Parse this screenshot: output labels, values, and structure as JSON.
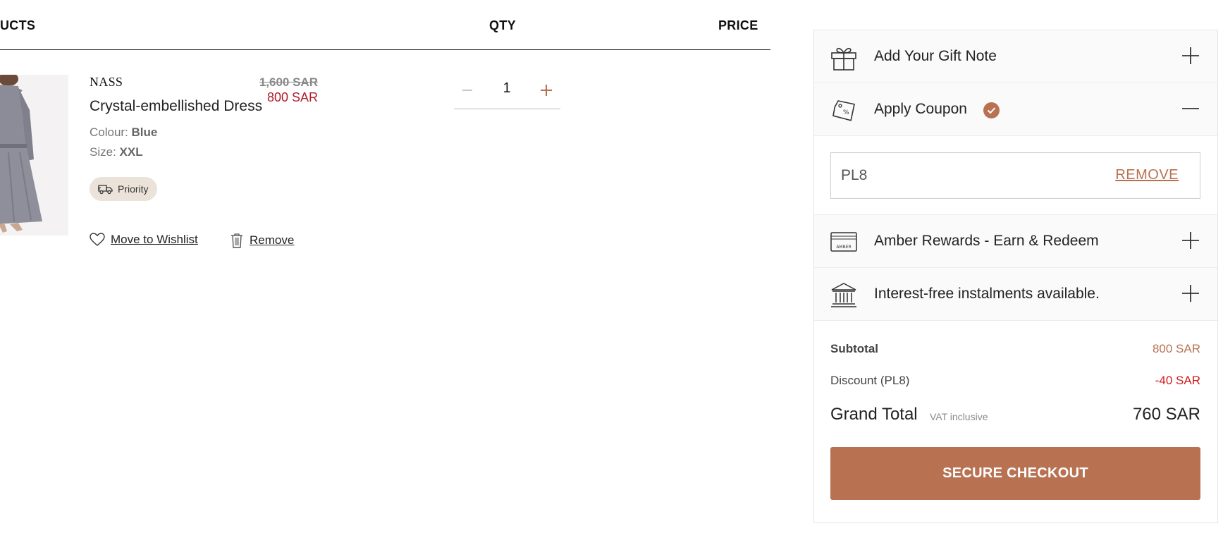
{
  "table": {
    "col_products": "UCTS",
    "col_qty": "QTY",
    "col_price": "PRICE"
  },
  "item": {
    "brand": "NASS",
    "name": "Crystal-embellished Dress",
    "colour_label": "Colour: ",
    "colour_value": "Blue",
    "size_label": "Size: ",
    "size_value": "XXL",
    "badge": "Priority",
    "wishlist_label": "Move to Wishlist",
    "remove_label": "Remove",
    "quantity": "1",
    "price_old": "1,600 SAR",
    "price_new": "800 SAR"
  },
  "summary": {
    "gift_note": "Add Your Gift Note",
    "apply_coupon": "Apply Coupon",
    "coupon_code": "PL8",
    "coupon_remove": "REMOVE",
    "rewards": "Amber Rewards - Earn & Redeem",
    "rewards_card_text": "AMBER",
    "instalments": "Interest-free instalments available.",
    "subtotal_label": "Subtotal",
    "subtotal_value": "800 SAR",
    "discount_label": "Discount (PL8)",
    "discount_value": "-40 SAR",
    "grand_total_label": "Grand Total",
    "vat_note": "VAT inclusive",
    "grand_total_value": "760 SAR",
    "checkout_label": "SECURE CHECKOUT"
  },
  "colors": {
    "accent": "#b87252",
    "sale_red": "#b21d2b",
    "discount_red": "#d21a1a"
  },
  "icons": {
    "gift": "gift-icon",
    "coupon": "coupon-tag-icon",
    "rewards": "rewards-card-icon",
    "bank": "bank-icon",
    "plus": "plus-icon",
    "minus": "minus-icon",
    "heart": "heart-icon",
    "trash": "trash-icon",
    "truck": "truck-icon",
    "check": "check-icon"
  }
}
